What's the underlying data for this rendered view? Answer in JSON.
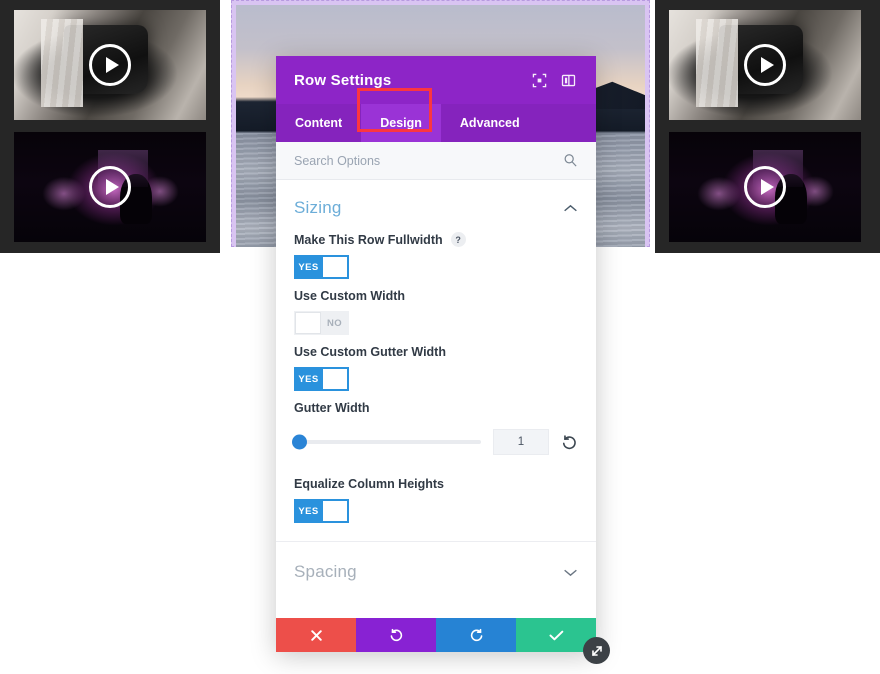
{
  "canvas": {
    "left_column": {
      "videos": [
        {
          "name": "camera-gear-video",
          "play_label": "play"
        },
        {
          "name": "concert-lights-video",
          "play_label": "play"
        }
      ]
    },
    "center_row": {
      "photo_name": "lake-sunset-photo",
      "highlighted": true
    },
    "right_column": {
      "videos": [
        {
          "name": "camera-gear-video",
          "play_label": "play"
        },
        {
          "name": "concert-lights-video",
          "play_label": "play"
        }
      ]
    }
  },
  "modal": {
    "title": "Row Settings",
    "header_icons": [
      {
        "name": "fullscreen-icon",
        "glyph": "expand"
      },
      {
        "name": "panel-layout-icon",
        "glyph": "panel"
      }
    ],
    "tabs": [
      {
        "label": "Content",
        "active": false
      },
      {
        "label": "Design",
        "active": true,
        "highlighted": true
      },
      {
        "label": "Advanced",
        "active": false
      }
    ],
    "search": {
      "placeholder": "Search Options",
      "value": "",
      "icon": "search-icon"
    },
    "sections": [
      {
        "title": "Sizing",
        "expanded": true,
        "chevron": "chevron-up-icon",
        "fields": [
          {
            "type": "toggle",
            "label": "Make This Row Fullwidth",
            "has_help": true,
            "help_glyph": "?",
            "state": "YES",
            "on": true
          },
          {
            "type": "toggle",
            "label": "Use Custom Width",
            "has_help": false,
            "state": "NO",
            "on": false
          },
          {
            "type": "toggle",
            "label": "Use Custom Gutter Width",
            "has_help": false,
            "state": "YES",
            "on": true
          },
          {
            "type": "slider",
            "label": "Gutter Width",
            "value": "1",
            "slider_percent": 0,
            "reset_icon": "reset-icon"
          },
          {
            "type": "toggle",
            "label": "Equalize Column Heights",
            "has_help": false,
            "state": "YES",
            "on": true
          }
        ]
      },
      {
        "title": "Spacing",
        "expanded": false,
        "chevron": "chevron-down-icon",
        "fields": []
      }
    ],
    "actions": [
      {
        "name": "cancel-button",
        "icon": "close-icon",
        "color": "#ed4f4a"
      },
      {
        "name": "undo-button",
        "icon": "undo-icon",
        "color": "#8822d3"
      },
      {
        "name": "redo-button",
        "icon": "redo-icon",
        "color": "#2683d4"
      },
      {
        "name": "save-button",
        "icon": "check-icon",
        "color": "#2bc490"
      }
    ],
    "resize_handle": {
      "name": "resize-handle",
      "icon": "diagonal-arrow-icon"
    }
  },
  "colors": {
    "header_purple": "#8d25c7",
    "tabs_purple": "#8523bd",
    "tab_active_purple": "#9a33d6",
    "highlight_red": "#fb3640",
    "toggle_blue": "#2a92dd",
    "section_title_blue": "#6cadd8",
    "row_highlight_lavender": "#d9c4f2",
    "canvas_dark": "#262626"
  }
}
